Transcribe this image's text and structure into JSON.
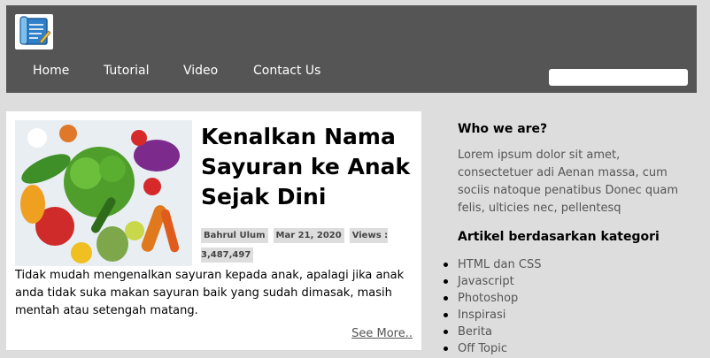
{
  "nav": [
    "Home",
    "Tutorial",
    "Video",
    "Contact Us"
  ],
  "search": {
    "placeholder": ""
  },
  "article": {
    "title": "Kenalkan Nama Sayuran ke Anak Sejak Dini",
    "author": "Bahrul Ulum",
    "date": "Mar 21, 2020",
    "views": "Views : 3,487,497",
    "excerpt": "Tidak mudah mengenalkan sayuran kepada anak, apalagi jika anak anda tidak suka makan sayuran baik yang sudah dimasak, masih mentah atau setengah matang.",
    "see_more": "See More.."
  },
  "sidebar": {
    "about_title": "Who we are?",
    "about_text": "Lorem ipsum dolor sit amet, consectetuer adi Aenan massa, cum sociis natoque penatibus Donec quam felis, ulticies nec, pellentesq",
    "categories_title": "Artikel berdasarkan kategori",
    "categories": [
      "HTML dan CSS",
      "Javascript",
      "Photoshop",
      "Inspirasi",
      "Berita",
      "Off Topic"
    ]
  },
  "icons": {
    "logo": "notepad-quill-icon"
  },
  "colors": {
    "header": "#555555",
    "page": "#dddddd",
    "card": "#ffffff"
  }
}
